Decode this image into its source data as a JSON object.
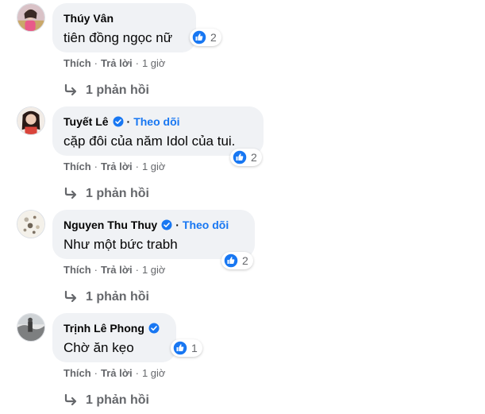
{
  "comments": [
    {
      "name": "Thúy Vân",
      "verified": false,
      "follow": "",
      "text": "tiên đồng ngọc nữ",
      "reaction_icon": "like-icon",
      "reaction_count": "2",
      "like_label": "Thích",
      "reply_label": "Trả lời",
      "time": "1 giờ",
      "replies_label": "1 phản hồi"
    },
    {
      "name": "Tuyết Lê",
      "verified": true,
      "follow": "Theo dõi",
      "text": "cặp đôi của năm Idol của tui.",
      "reaction_icon": "like-icon",
      "reaction_count": "2",
      "like_label": "Thích",
      "reply_label": "Trả lời",
      "time": "1 giờ",
      "replies_label": "1 phản hồi"
    },
    {
      "name": "Nguyen Thu Thuy",
      "verified": true,
      "follow": "Theo dõi",
      "text": "Như một bức trabh",
      "reaction_icon": "like-icon",
      "reaction_count": "2",
      "like_label": "Thích",
      "reply_label": "Trả lời",
      "time": "1 giờ",
      "replies_label": "1 phản hồi"
    },
    {
      "name": "Trịnh Lê Phong",
      "verified": true,
      "follow": "",
      "text": "Chờ ăn kẹo",
      "reaction_icon": "like-icon",
      "reaction_count": "1",
      "like_label": "Thích",
      "reply_label": "Trả lời",
      "time": "1 giờ",
      "replies_label": "1 phản hồi"
    }
  ],
  "colors": {
    "bubble": "#f0f2f5",
    "link_blue": "#1877f2",
    "secondary_text": "#65676b"
  }
}
